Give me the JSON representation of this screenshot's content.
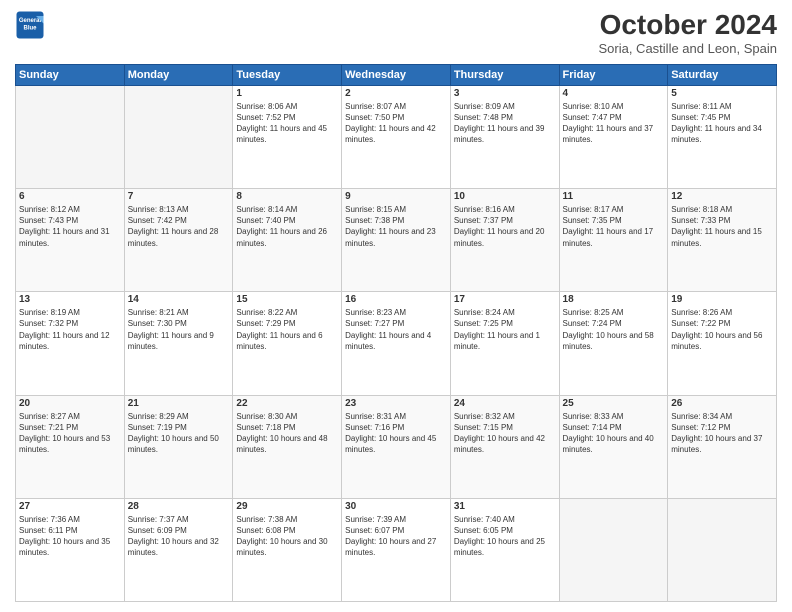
{
  "logo": {
    "line1": "General",
    "line2": "Blue"
  },
  "title": "October 2024",
  "subtitle": "Soria, Castille and Leon, Spain",
  "days_of_week": [
    "Sunday",
    "Monday",
    "Tuesday",
    "Wednesday",
    "Thursday",
    "Friday",
    "Saturday"
  ],
  "weeks": [
    [
      {
        "day": "",
        "info": ""
      },
      {
        "day": "",
        "info": ""
      },
      {
        "day": "1",
        "info": "Sunrise: 8:06 AM\nSunset: 7:52 PM\nDaylight: 11 hours and 45 minutes."
      },
      {
        "day": "2",
        "info": "Sunrise: 8:07 AM\nSunset: 7:50 PM\nDaylight: 11 hours and 42 minutes."
      },
      {
        "day": "3",
        "info": "Sunrise: 8:09 AM\nSunset: 7:48 PM\nDaylight: 11 hours and 39 minutes."
      },
      {
        "day": "4",
        "info": "Sunrise: 8:10 AM\nSunset: 7:47 PM\nDaylight: 11 hours and 37 minutes."
      },
      {
        "day": "5",
        "info": "Sunrise: 8:11 AM\nSunset: 7:45 PM\nDaylight: 11 hours and 34 minutes."
      }
    ],
    [
      {
        "day": "6",
        "info": "Sunrise: 8:12 AM\nSunset: 7:43 PM\nDaylight: 11 hours and 31 minutes."
      },
      {
        "day": "7",
        "info": "Sunrise: 8:13 AM\nSunset: 7:42 PM\nDaylight: 11 hours and 28 minutes."
      },
      {
        "day": "8",
        "info": "Sunrise: 8:14 AM\nSunset: 7:40 PM\nDaylight: 11 hours and 26 minutes."
      },
      {
        "day": "9",
        "info": "Sunrise: 8:15 AM\nSunset: 7:38 PM\nDaylight: 11 hours and 23 minutes."
      },
      {
        "day": "10",
        "info": "Sunrise: 8:16 AM\nSunset: 7:37 PM\nDaylight: 11 hours and 20 minutes."
      },
      {
        "day": "11",
        "info": "Sunrise: 8:17 AM\nSunset: 7:35 PM\nDaylight: 11 hours and 17 minutes."
      },
      {
        "day": "12",
        "info": "Sunrise: 8:18 AM\nSunset: 7:33 PM\nDaylight: 11 hours and 15 minutes."
      }
    ],
    [
      {
        "day": "13",
        "info": "Sunrise: 8:19 AM\nSunset: 7:32 PM\nDaylight: 11 hours and 12 minutes."
      },
      {
        "day": "14",
        "info": "Sunrise: 8:21 AM\nSunset: 7:30 PM\nDaylight: 11 hours and 9 minutes."
      },
      {
        "day": "15",
        "info": "Sunrise: 8:22 AM\nSunset: 7:29 PM\nDaylight: 11 hours and 6 minutes."
      },
      {
        "day": "16",
        "info": "Sunrise: 8:23 AM\nSunset: 7:27 PM\nDaylight: 11 hours and 4 minutes."
      },
      {
        "day": "17",
        "info": "Sunrise: 8:24 AM\nSunset: 7:25 PM\nDaylight: 11 hours and 1 minute."
      },
      {
        "day": "18",
        "info": "Sunrise: 8:25 AM\nSunset: 7:24 PM\nDaylight: 10 hours and 58 minutes."
      },
      {
        "day": "19",
        "info": "Sunrise: 8:26 AM\nSunset: 7:22 PM\nDaylight: 10 hours and 56 minutes."
      }
    ],
    [
      {
        "day": "20",
        "info": "Sunrise: 8:27 AM\nSunset: 7:21 PM\nDaylight: 10 hours and 53 minutes."
      },
      {
        "day": "21",
        "info": "Sunrise: 8:29 AM\nSunset: 7:19 PM\nDaylight: 10 hours and 50 minutes."
      },
      {
        "day": "22",
        "info": "Sunrise: 8:30 AM\nSunset: 7:18 PM\nDaylight: 10 hours and 48 minutes."
      },
      {
        "day": "23",
        "info": "Sunrise: 8:31 AM\nSunset: 7:16 PM\nDaylight: 10 hours and 45 minutes."
      },
      {
        "day": "24",
        "info": "Sunrise: 8:32 AM\nSunset: 7:15 PM\nDaylight: 10 hours and 42 minutes."
      },
      {
        "day": "25",
        "info": "Sunrise: 8:33 AM\nSunset: 7:14 PM\nDaylight: 10 hours and 40 minutes."
      },
      {
        "day": "26",
        "info": "Sunrise: 8:34 AM\nSunset: 7:12 PM\nDaylight: 10 hours and 37 minutes."
      }
    ],
    [
      {
        "day": "27",
        "info": "Sunrise: 7:36 AM\nSunset: 6:11 PM\nDaylight: 10 hours and 35 minutes."
      },
      {
        "day": "28",
        "info": "Sunrise: 7:37 AM\nSunset: 6:09 PM\nDaylight: 10 hours and 32 minutes."
      },
      {
        "day": "29",
        "info": "Sunrise: 7:38 AM\nSunset: 6:08 PM\nDaylight: 10 hours and 30 minutes."
      },
      {
        "day": "30",
        "info": "Sunrise: 7:39 AM\nSunset: 6:07 PM\nDaylight: 10 hours and 27 minutes."
      },
      {
        "day": "31",
        "info": "Sunrise: 7:40 AM\nSunset: 6:05 PM\nDaylight: 10 hours and 25 minutes."
      },
      {
        "day": "",
        "info": ""
      },
      {
        "day": "",
        "info": ""
      }
    ]
  ]
}
